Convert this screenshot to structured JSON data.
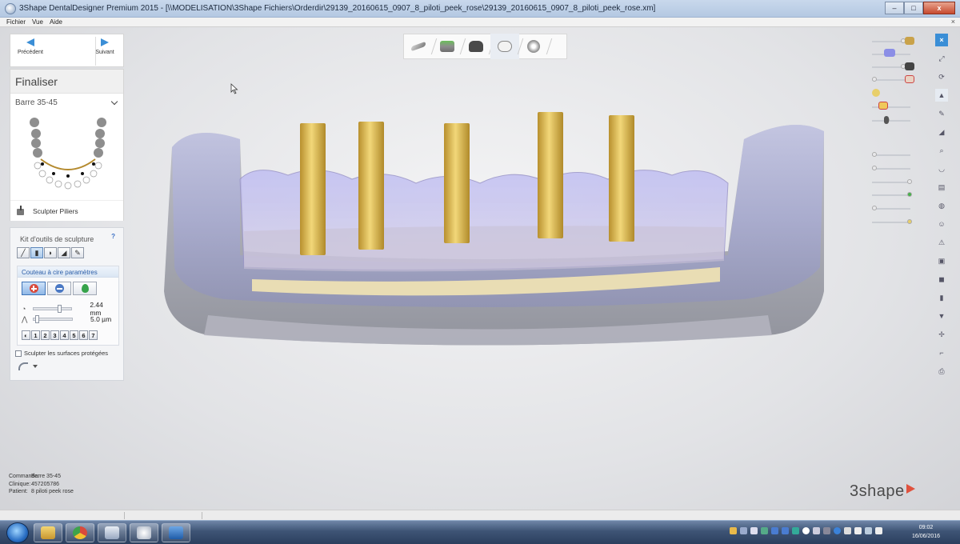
{
  "window": {
    "title": "3Shape DentalDesigner Premium 2015 - [\\\\MODELISATION\\3Shape Fichiers\\Orderdir\\29139_20160615_0907_8_piloti_peek_rose\\29139_20160615_0907_8_piloti_peek_rose.xm]",
    "minimize": "–",
    "maximize": "□",
    "close": "x"
  },
  "menu": {
    "items": [
      "Fichier",
      "Vue",
      "Aide"
    ],
    "close": "×"
  },
  "navigation": {
    "previous": "Précédent",
    "next": "Suivant"
  },
  "stage": {
    "title": "Finaliser",
    "dropdown_value": "Barre 35-45",
    "action_label": "Sculpter Piliers"
  },
  "toolkit": {
    "title": "Kit d'outils de sculpture",
    "help": "?",
    "params_title": "Couteau à cire paramètres",
    "size_value": "2.44 mm",
    "step_value": "5.0 µm",
    "presets": [
      "1",
      "2",
      "3",
      "4",
      "5",
      "6",
      "7"
    ],
    "protect_label": "Sculpter les surfaces protégées"
  },
  "order_info": {
    "rows": [
      {
        "key": "Commande:",
        "value": "Barre 35-45"
      },
      {
        "key": "Clinique:",
        "value": "457205786"
      },
      {
        "key": "Patient:",
        "value": "8 piloti peek rose"
      }
    ]
  },
  "brand": {
    "logo_text": "3shape",
    "accent": "#e0523e"
  },
  "taskbar": {
    "time": "09:02",
    "date": "16/06/2016"
  },
  "colors": {
    "accent_blue": "#3a8ed6",
    "abutment_gold": "#d8b24a",
    "model_lavender": "#a9aee9"
  }
}
